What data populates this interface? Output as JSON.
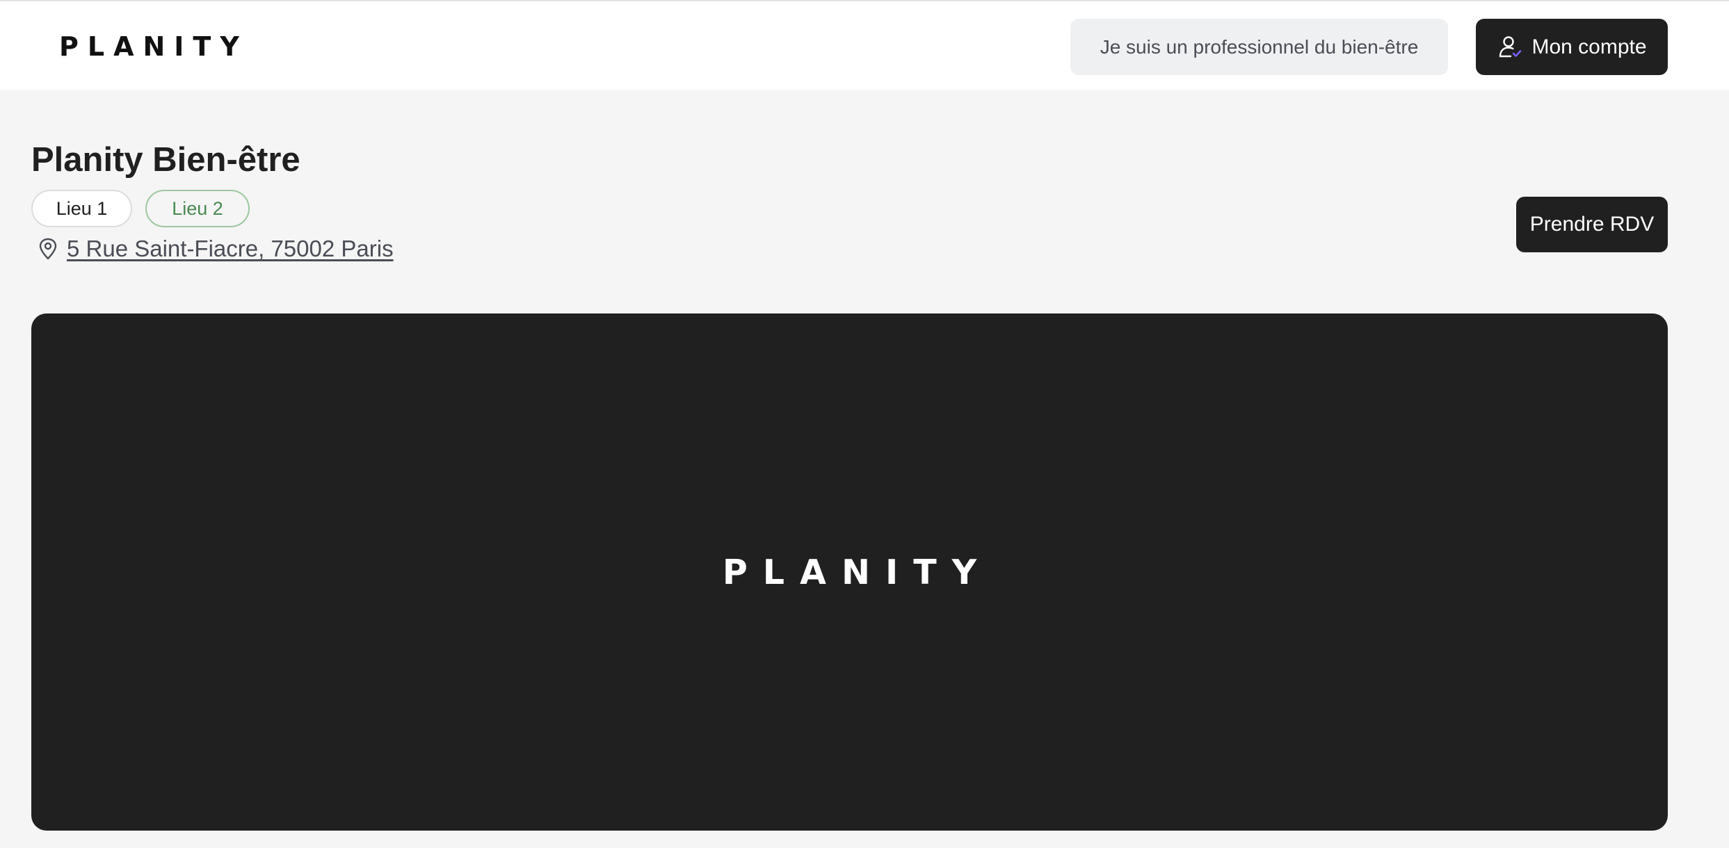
{
  "header": {
    "logo_text": "PLANITY",
    "pro_button_label": "Je suis un professionnel du bien-être",
    "account_button_label": "Mon compte",
    "account_icon": "user-check-icon"
  },
  "business": {
    "name": "Planity Bien-être",
    "locations": [
      {
        "label": "Lieu 1",
        "selected": false
      },
      {
        "label": "Lieu 2",
        "selected": true
      }
    ],
    "address": "5 Rue Saint-Fiacre, 75002 Paris",
    "address_icon": "map-pin-icon",
    "book_button_label": "Prendre RDV"
  },
  "hero": {
    "logo_text": "PLANITY"
  },
  "colors": {
    "primary_dark": "#202020",
    "selected_location_border": "#9cc89f",
    "selected_location_text": "#4a8a51",
    "account_icon_accent": "#7b61ff",
    "page_background": "#f5f5f5"
  }
}
